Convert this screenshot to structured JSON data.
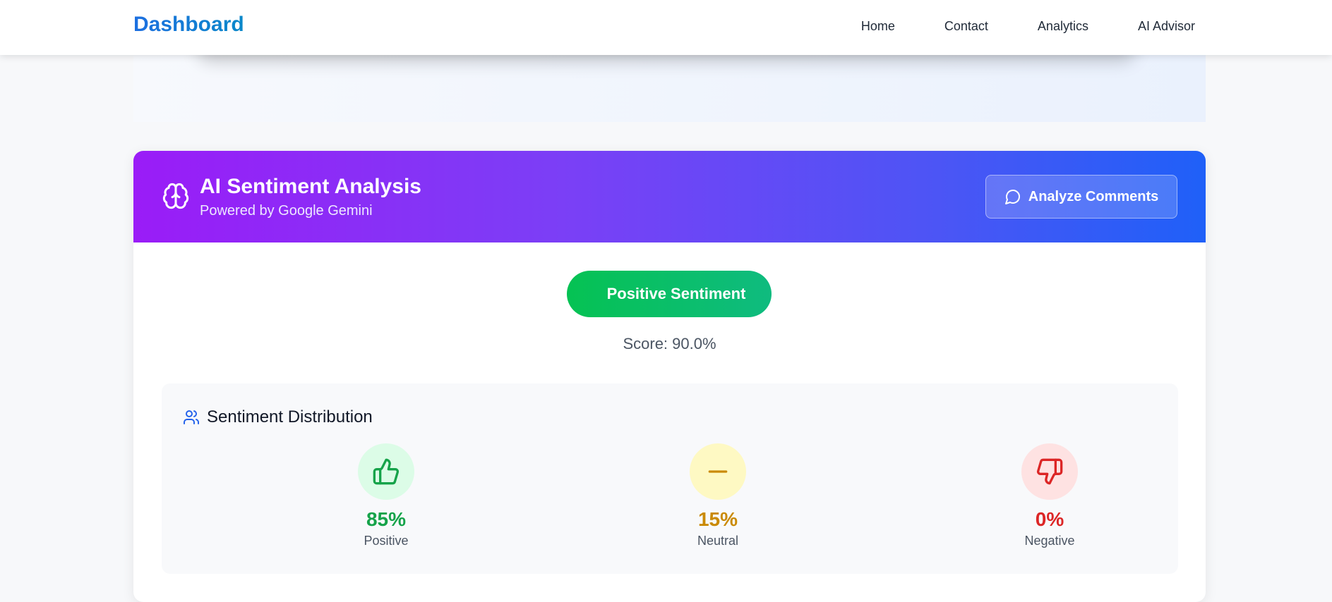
{
  "nav": {
    "brand": "Dashboard",
    "links": [
      "Home",
      "Contact",
      "Analytics",
      "AI Advisor"
    ]
  },
  "sentiment_card": {
    "title": "AI Sentiment Analysis",
    "subtitle": "Powered by Google Gemini",
    "analyze_button": "Analyze Comments",
    "overall_label": "Positive Sentiment",
    "score_text": "Score: 90.0%"
  },
  "distribution": {
    "title": "Sentiment Distribution",
    "items": [
      {
        "value": "85%",
        "label": "Positive",
        "icon": "thumbs-up-icon",
        "color": "#16a34a",
        "bg": "#dcfce7"
      },
      {
        "value": "15%",
        "label": "Neutral",
        "icon": "minus-icon",
        "color": "#ca8a04",
        "bg": "#fef9c3"
      },
      {
        "value": "0%",
        "label": "Negative",
        "icon": "thumbs-down-icon",
        "color": "#dc2626",
        "bg": "#fee2e2"
      }
    ]
  },
  "colors": {
    "brand_blue": "#1565d8",
    "header_gradient_start": "#9a1cf7",
    "header_gradient_end": "#1f60f8",
    "positive_green": "#05c253"
  }
}
